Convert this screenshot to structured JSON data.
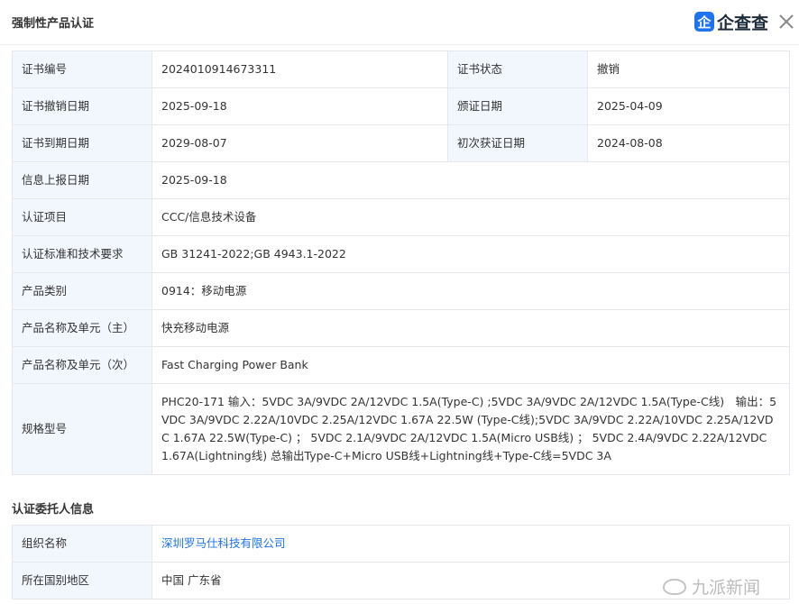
{
  "header": {
    "title": "强制性产品认证",
    "logo_mark": "企",
    "logo_text": "企查查"
  },
  "certificate": {
    "rows": [
      {
        "label": "证书编号",
        "value": "2024010914673311",
        "label2": "证书状态",
        "value2": "撤销"
      },
      {
        "label": "证书撤销日期",
        "value": "2025-09-18",
        "label2": "颁证日期",
        "value2": "2025-04-09"
      },
      {
        "label": "证书到期日期",
        "value": "2029-08-07",
        "label2": "初次获证日期",
        "value2": "2024-08-08"
      }
    ],
    "info_date_label": "信息上报日期",
    "info_date": "2025-09-18",
    "item_label": "认证项目",
    "item": "CCC/信息技术设备",
    "standard_label": "认证标准和技术要求",
    "standard": "GB 31241-2022;GB 4943.1-2022",
    "category_label": "产品类别",
    "category": "0914：移动电源",
    "name_main_label": "产品名称及单元（主）",
    "name_main": "快充移动电源",
    "name_sub_label": "产品名称及单元（次）",
    "name_sub": "Fast Charging Power Bank",
    "spec_label": "规格型号",
    "spec": "PHC20-171 输入：5VDC 3A/9VDC 2A/12VDC 1.5A(Type-C) ;5VDC 3A/9VDC 2A/12VDC 1.5A(Type-C线)　输出：5VDC 3A/9VDC 2.22A/10VDC 2.25A/12VDC 1.67A 22.5W (Type-C线);5VDC 3A/9VDC 2.22A/10VDC 2.25A/12VDC 1.67A 22.5W(Type-C) ； 5VDC 2.1A/9VDC 2A/12VDC 1.5A(Micro USB线) ； 5VDC 2.4A/9VDC 2.22A/12VDC 1.67A(Lightning线) 总输出Type-C+Micro USB线+Lightning线+Type-C线=5VDC 3A"
  },
  "applicant": {
    "section_title": "认证委托人信息",
    "org_label": "组织名称",
    "org": "深圳罗马仕科技有限公司",
    "region_label": "所在国别地区",
    "region": "中国 广东省"
  },
  "watermark": "九派新闻",
  "colors": {
    "label_bg": "#f2f7fd",
    "border": "#e4e7ed",
    "link": "#1e73ee"
  }
}
